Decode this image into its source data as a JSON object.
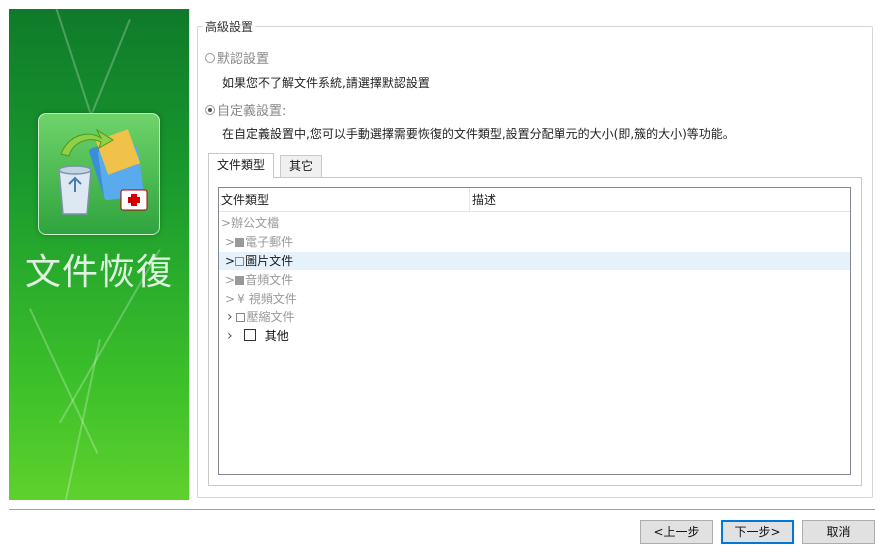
{
  "banner": {
    "title": "文件恢復",
    "icon": "recycle-bin-folder-icon"
  },
  "group": {
    "legend": "高級設置",
    "default_option": {
      "label": "默認設置",
      "selected": false
    },
    "default_desc": "如果您不了解文件系統,請選擇默認設置",
    "custom_option": {
      "label": "自定義設置:",
      "selected": true
    },
    "custom_desc": "在自定義設置中,您可以手動選擇需要恢復的文件類型,設置分配單元的大小(即,簇的大小)等功能。"
  },
  "tabs": [
    {
      "label": "文件類型",
      "active": true
    },
    {
      "label": "其它",
      "active": false
    }
  ],
  "list": {
    "columns": [
      "文件類型",
      "描述"
    ],
    "rows": [
      {
        "caret": ">",
        "checkbox": "none",
        "label": "辦公文檔",
        "style": "faded",
        "indent": 0
      },
      {
        "caret": ">",
        "checkbox": "filled",
        "label": "電子郵件",
        "style": "faded",
        "indent": 1
      },
      {
        "caret": ">",
        "checkbox": "empty",
        "label": "圖片文件",
        "style": "normal",
        "indent": 1,
        "selected": true
      },
      {
        "caret": ">",
        "checkbox": "filled",
        "label": "音頻文件",
        "style": "faded",
        "indent": 1
      },
      {
        "caret": ">",
        "checkbox": "yen",
        "label": "視頻文件",
        "style": "faded",
        "indent": 1
      },
      {
        "caret": "›",
        "checkbox": "empty",
        "label": "壓縮文件",
        "style": "faded",
        "indent": 1
      },
      {
        "caret": "›",
        "checkbox": "empty",
        "label": "其他",
        "style": "strong",
        "indent": 1
      }
    ]
  },
  "buttons": {
    "back": "<上一步",
    "next": "下一步>",
    "cancel": "取消"
  },
  "colors": {
    "banner_top": "#0f7a2a",
    "banner_bottom": "#5fd12d",
    "selected_row": "#e5f1fb",
    "default_button_border": "#0078d7"
  }
}
